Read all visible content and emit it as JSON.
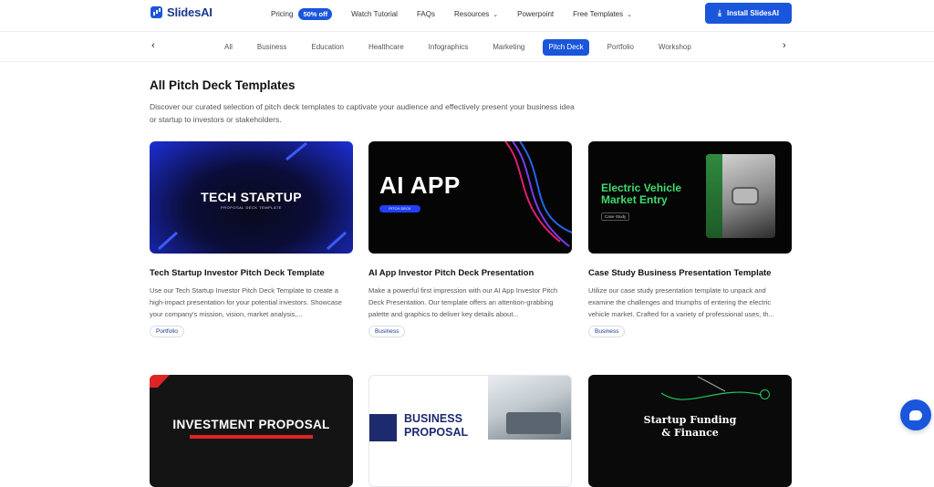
{
  "header": {
    "brand": "SlidesAI",
    "nav": {
      "pricing": "Pricing",
      "pricing_badge": "50% off",
      "watch_tutorial": "Watch Tutorial",
      "faqs": "FAQs",
      "resources": "Resources",
      "powerpoint": "Powerpoint",
      "free_templates": "Free Templates"
    },
    "install_label": "Install SlidesAI"
  },
  "categories": {
    "items": [
      "All",
      "Business",
      "Education",
      "Healthcare",
      "Infographics",
      "Marketing",
      "Pitch Deck",
      "Portfolio",
      "Workshop"
    ],
    "active": "Pitch Deck"
  },
  "section": {
    "title": "All Pitch Deck Templates",
    "description": "Discover our curated selection of pitch deck templates to captivate your audience and effectively present your business idea or startup to investors or stakeholders."
  },
  "cards": [
    {
      "thumb_title": "TECH STARTUP",
      "thumb_subtitle": "PROPOSAL DECK TEMPLATE",
      "title": "Tech Startup Investor Pitch Deck Template",
      "description": "Use our Tech Startup Investor Pitch Deck Template to create a high-impact presentation for your potential investors. Showcase your company's mission, vision, market analysis,...",
      "tag": "Portfolio"
    },
    {
      "thumb_title": "AI APP",
      "thumb_subtitle": "PITCH DECK",
      "title": "AI App Investor Pitch Deck Presentation",
      "description": "Make a powerful first impression with our AI App Investor Pitch Deck Presentation. Our template offers an attention-grabbing palette and graphics to deliver key details about...",
      "tag": "Business"
    },
    {
      "thumb_title": "Electric Vehicle Market Entry",
      "thumb_subtitle": "Case Study",
      "title": "Case Study Business Presentation Template",
      "description": "Utilize our case study presentation template to unpack and examine the challenges and triumphs of entering the electric vehicle market. Crafted for a variety of professional uses, th...",
      "tag": "Business"
    },
    {
      "thumb_title": "INVESTMENT PROPOSAL"
    },
    {
      "thumb_title": "BUSINESS PROPOSAL"
    },
    {
      "thumb_title": "Startup Funding & Finance"
    }
  ],
  "colors": {
    "accent": "#1a56db",
    "brand_dark": "#1a3a8f"
  },
  "icons": {
    "download": "download-icon",
    "prev": "chevron-left-icon",
    "next": "chevron-right-icon",
    "chat": "chat-bubble-icon"
  }
}
